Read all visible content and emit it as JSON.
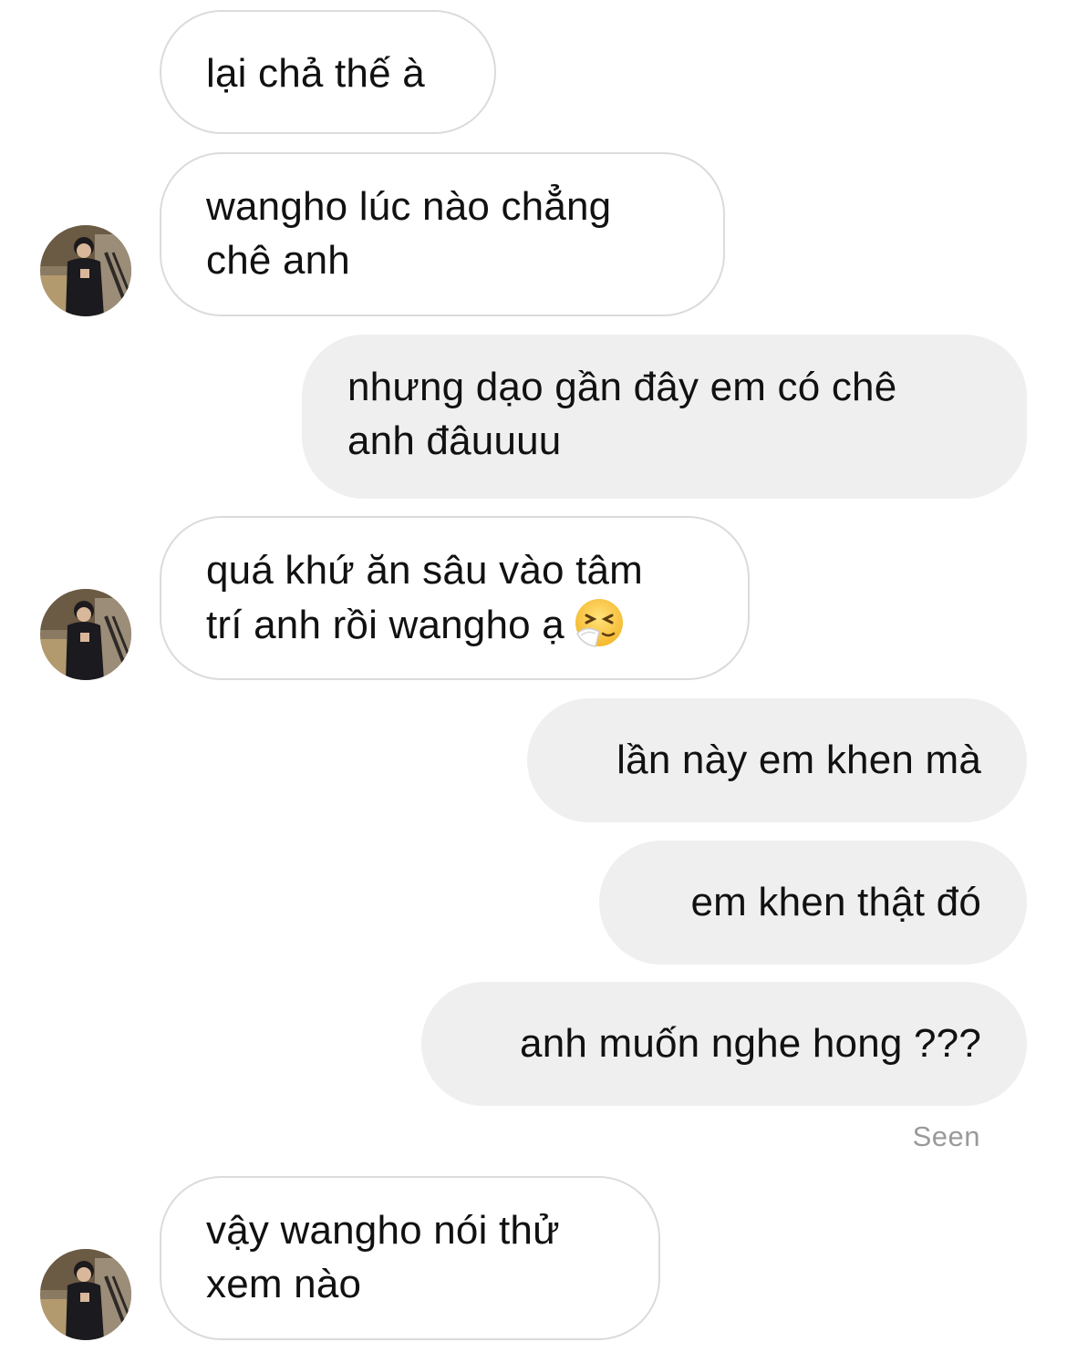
{
  "messages": [
    {
      "from": "them",
      "lines": [
        "lại chả thế à"
      ]
    },
    {
      "from": "them",
      "lines": [
        "wangho lúc nào chẳng",
        "chê anh"
      ]
    },
    {
      "from": "me",
      "lines": [
        "nhưng dạo gần đây em có chê",
        "anh đâuuuu"
      ]
    },
    {
      "from": "them",
      "lines": [
        "quá khứ ăn sâu vào tâm",
        "trí anh rồi wangho ạ"
      ],
      "emoji": "sneezing-face-icon"
    },
    {
      "from": "me",
      "lines": [
        "lần này em khen mà"
      ]
    },
    {
      "from": "me",
      "lines": [
        "em khen thật đó"
      ]
    },
    {
      "from": "me",
      "lines": [
        "anh muốn nghe hong ???"
      ]
    },
    {
      "from": "them",
      "lines": [
        "vậy wangho nói thử",
        "xem nào"
      ]
    }
  ],
  "status": {
    "seen_label": "Seen"
  },
  "colors": {
    "sent_bubble": "#efefef",
    "received_border": "#dbdbdb",
    "seen_text": "#9a9a9a"
  }
}
